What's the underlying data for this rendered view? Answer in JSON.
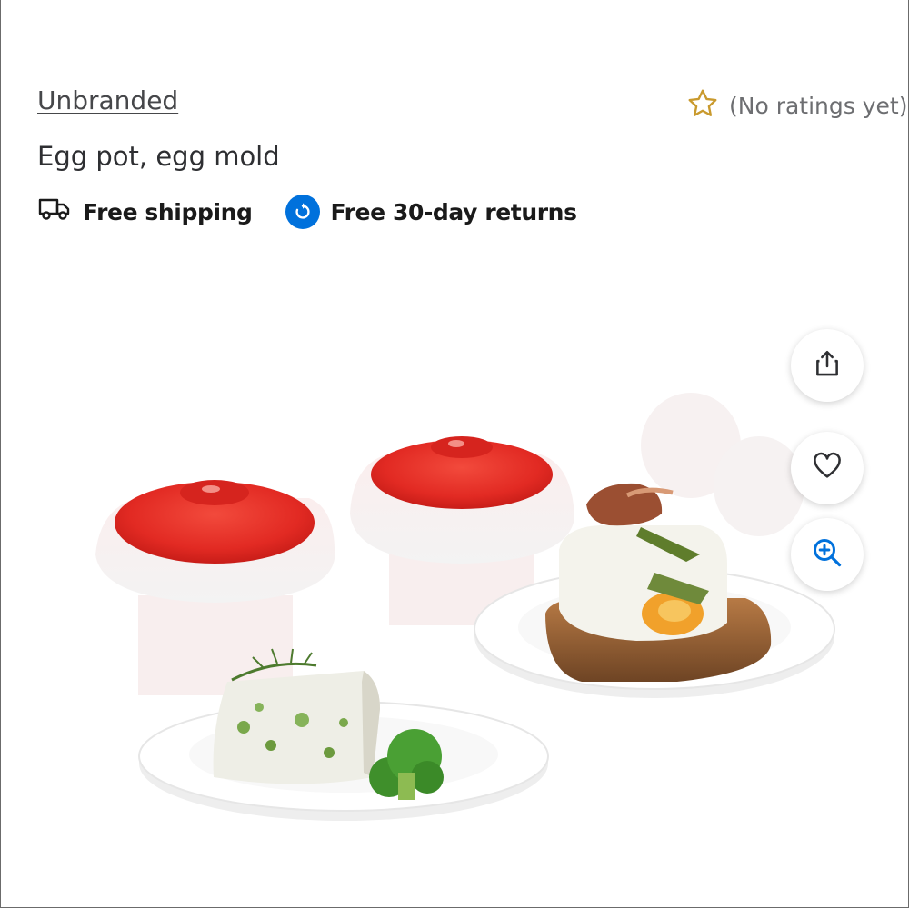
{
  "product": {
    "brand": "Unbranded",
    "title": "Egg pot, egg mold",
    "rating_text": "(No ratings yet)"
  },
  "perks": {
    "shipping": "Free shipping",
    "returns": "Free 30-day returns"
  },
  "icons": {
    "star": "star-outline-icon",
    "truck": "truck-icon",
    "returns": "returns-icon",
    "share": "share-icon",
    "favorite": "heart-icon",
    "zoom": "zoom-in-icon"
  },
  "colors": {
    "accent_blue": "#0071dc",
    "star_gold": "#c99a2e",
    "lid_red": "#e22a23"
  }
}
